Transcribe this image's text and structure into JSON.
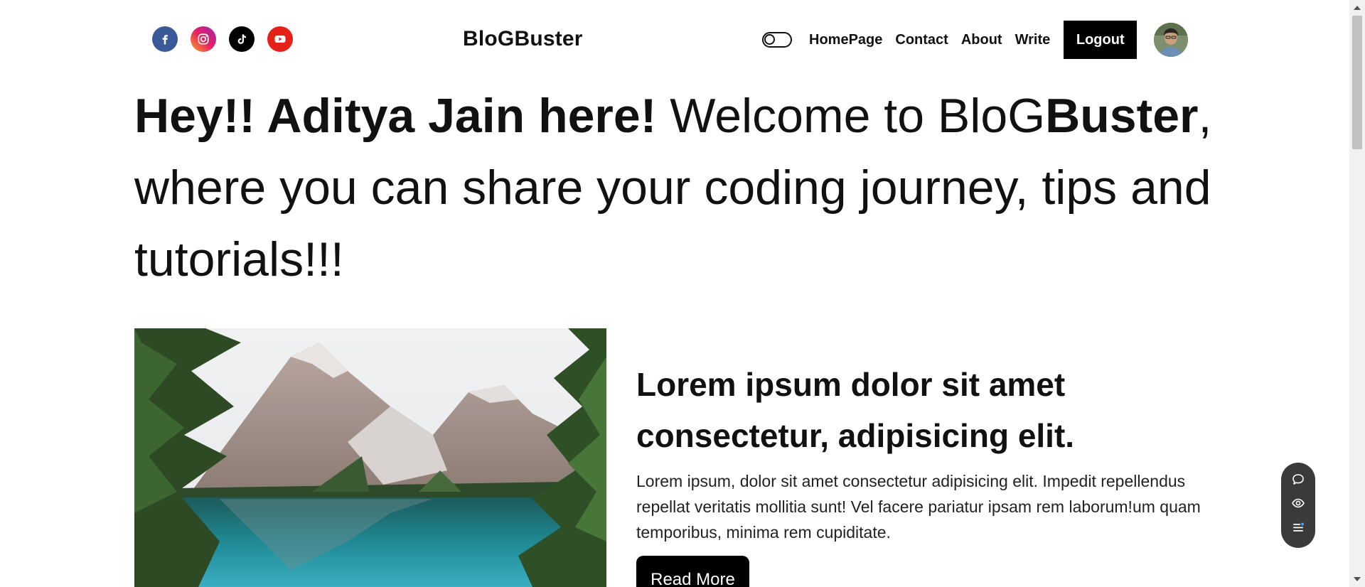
{
  "navbar": {
    "logo": "BloGBuster",
    "socials": [
      {
        "name": "facebook-icon",
        "color": "#3b5998"
      },
      {
        "name": "instagram-icon",
        "color": "#e91e63"
      },
      {
        "name": "tiktok-icon",
        "color": "#000000"
      },
      {
        "name": "youtube-icon",
        "color": "#e62117"
      }
    ],
    "links": [
      "HomePage",
      "Contact",
      "About",
      "Write"
    ],
    "logout_label": "Logout"
  },
  "hero": {
    "greeting_bold": "Hey!! Aditya Jain here!",
    "welcome": " Welcome to ",
    "brand_plain": "BloG",
    "brand_bold": "Buster",
    "rest": ", where you can share your coding journey, tips and tutorials!!!"
  },
  "post": {
    "title": "Lorem ipsum dolor sit amet consectetur, adipisicing elit.",
    "description": "Lorem ipsum, dolor sit amet consectetur adipisicing elit. Impedit repellendus repellat veritatis mollitia sunt! Vel facere pariatur ipsam rem laborum!um quam temporibus, minima rem cupiditate.",
    "read_more_label": "Read More"
  },
  "floating_toolbar": {
    "icons": [
      "chat-icon",
      "eye-icon",
      "list-icon"
    ]
  }
}
